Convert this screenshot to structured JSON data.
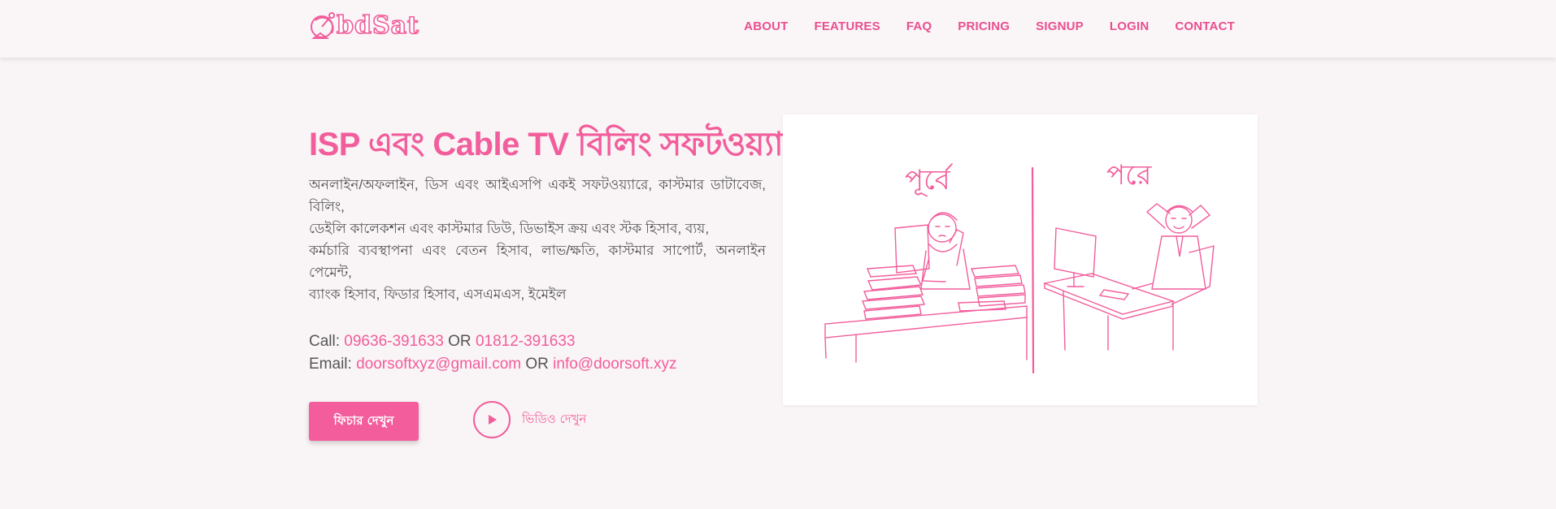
{
  "brand": {
    "logo_text": "bdSat",
    "accent_color": "#f25d9c",
    "logo_icon": "satellite-dish-icon"
  },
  "nav": {
    "items": [
      "ABOUT",
      "FEATURES",
      "FAQ",
      "PRICING",
      "SIGNUP",
      "LOGIN",
      "CONTACT"
    ]
  },
  "hero": {
    "title": "ISP এবং Cable TV বিলিং সফটওয়্যার",
    "description_lines": [
      "অনলাইন/অফলাইন, ডিস এবং আইএসপি একই সফটওয়্যারে, কাস্টমার ডাটাবেজ, বিলিং,",
      "ডেইলি কালেকশন এবং কাস্টমার ডিউ, ডিভাইস ক্রয় এবং স্টক হিসাব, ব্যয়,",
      "কর্মচারি ব্যবস্থাপনা এবং বেতন হিসাব, লাভ/ক্ষতি, কাস্টমার সাপোর্ট, অনলাইন পেমেন্ট,",
      "ব্যাংক হিসাব, ফিডার হিসাব, এসএমএস, ইমেইল"
    ],
    "call_label": "Call:",
    "phone_1": "09636-391633",
    "phone_or": "OR",
    "phone_2": "01812-391633",
    "email_label": "Email:",
    "email_1": "doorsoftxyz@gmail.com",
    "email_or": "OR",
    "email_2": "info@doorsoft.xyz",
    "feature_button": "ফিচার দেখুন",
    "video_button": "ভিডিও দেখুন",
    "play_icon": "play-icon"
  },
  "illustration": {
    "label_before": "পূর্বে",
    "label_after": "পরে",
    "line_color": "#f25d9c"
  }
}
